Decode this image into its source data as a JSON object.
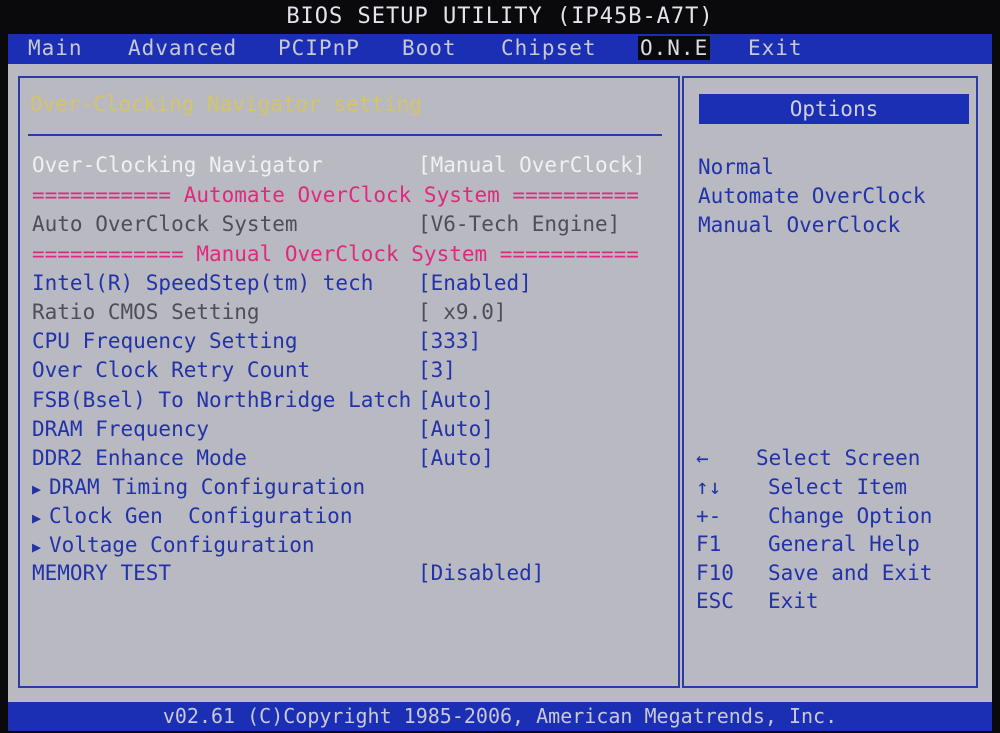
{
  "title": "BIOS SETUP UTILITY (IP45B-A7T)",
  "menu": [
    {
      "label": "Main"
    },
    {
      "label": "Advanced"
    },
    {
      "label": "PCIPnP"
    },
    {
      "label": "Boot"
    },
    {
      "label": "Chipset"
    },
    {
      "label": "O.N.E",
      "active": true
    },
    {
      "label": "Exit"
    }
  ],
  "section_title": "Over-Clocking Navigator setting",
  "settings": {
    "oc_navigator": {
      "label": "Over-Clocking Navigator",
      "value": "[Manual OverClock]"
    },
    "sep_auto": "=========== Automate OverClock System ===========",
    "auto_oc": {
      "label": "Auto OverClock System",
      "value": "[V6-Tech Engine]"
    },
    "sep_manual": "============ Manual OverClock System ============",
    "speedstep": {
      "label": "Intel(R) SpeedStep(tm) tech",
      "value": "[Enabled]"
    },
    "ratio": {
      "label": "Ratio CMOS Setting",
      "value": "[ x9.0]"
    },
    "cpu_freq": {
      "label": "CPU Frequency Setting",
      "value": "[333]"
    },
    "retry": {
      "label": "Over Clock Retry Count",
      "value": "[3]"
    },
    "fsb": {
      "label": "FSB(Bsel) To NorthBridge Latch",
      "value": "[Auto]"
    },
    "dram_freq": {
      "label": "DRAM Frequency",
      "value": "[Auto]"
    },
    "ddr2": {
      "label": "DDR2 Enhance Mode",
      "value": "[Auto]"
    },
    "dram_timing": {
      "label": "DRAM Timing Configuration"
    },
    "clock_gen": {
      "label": "Clock Gen  Configuration"
    },
    "voltage": {
      "label": "Voltage Configuration"
    },
    "memtest": {
      "label": "MEMORY TEST",
      "value": "[Disabled]"
    }
  },
  "options": {
    "header": "Options",
    "items": [
      "Normal",
      "Automate OverClock",
      "Manual OverClock"
    ]
  },
  "help": [
    {
      "key": "←",
      "text": "Select Screen"
    },
    {
      "key": "↑↓",
      "text": "Select Item"
    },
    {
      "key": "+-",
      "text": "Change Option"
    },
    {
      "key": "F1",
      "text": "General Help"
    },
    {
      "key": "F10",
      "text": "Save and Exit"
    },
    {
      "key": "ESC",
      "text": "Exit"
    }
  ],
  "footer": "v02.61 (C)Copyright 1985-2006, American Megatrends, Inc."
}
